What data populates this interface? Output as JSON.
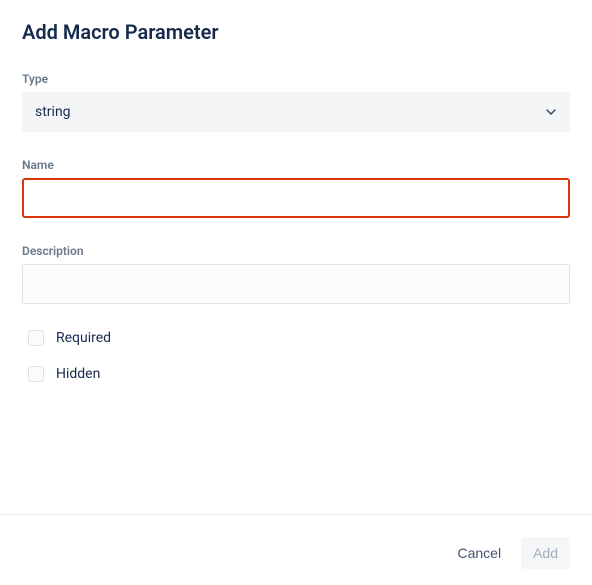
{
  "dialog": {
    "title": "Add Macro Parameter"
  },
  "fields": {
    "type": {
      "label": "Type",
      "value": "string"
    },
    "name": {
      "label": "Name",
      "value": ""
    },
    "description": {
      "label": "Description",
      "value": ""
    }
  },
  "checkboxes": {
    "required": {
      "label": "Required",
      "checked": false
    },
    "hidden": {
      "label": "Hidden",
      "checked": false
    }
  },
  "footer": {
    "cancel": "Cancel",
    "add": "Add"
  }
}
